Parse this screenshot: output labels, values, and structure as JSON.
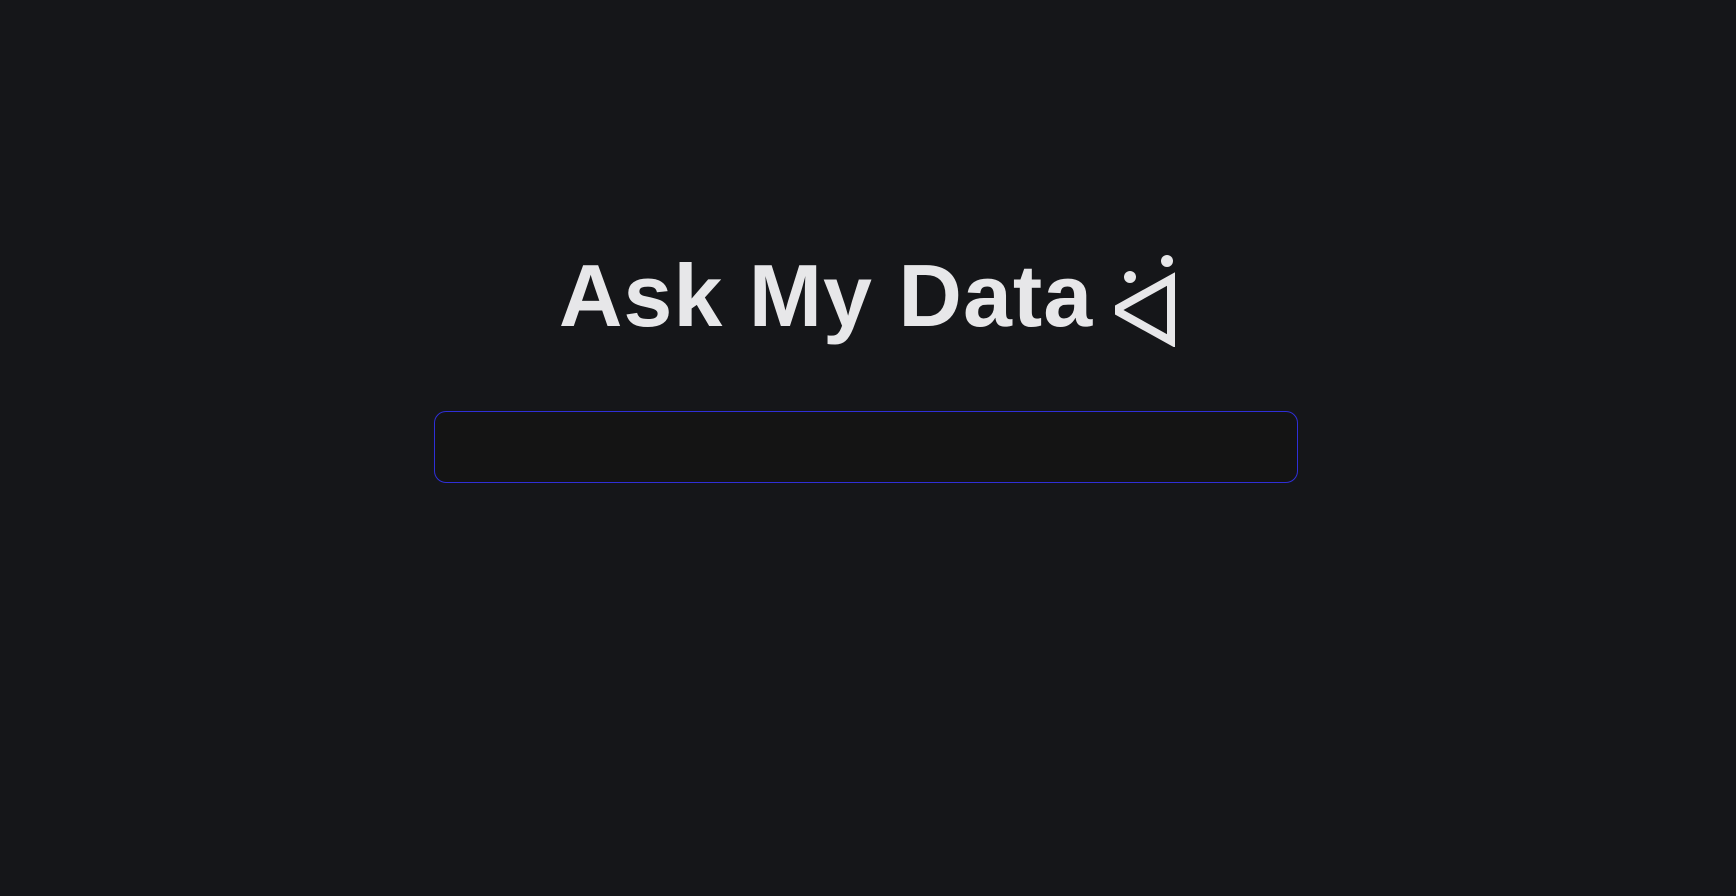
{
  "app": {
    "title": "Ask My Data",
    "logo_icon": "ai-spark-logo-icon"
  },
  "search": {
    "value": "",
    "placeholder": ""
  },
  "colors": {
    "background": "#151619",
    "text": "#e7e7e9",
    "input_border": "#2f2fd6",
    "input_background": "#141414"
  }
}
